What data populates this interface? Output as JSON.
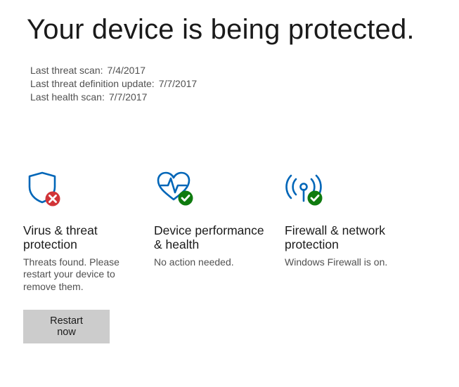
{
  "page": {
    "title": "Your device is being protected."
  },
  "scan": {
    "threat_scan_label": "Last threat scan:",
    "threat_scan_value": "7/4/2017",
    "definition_update_label": "Last threat definition update:",
    "definition_update_value": "7/7/2017",
    "health_scan_label": "Last health scan:",
    "health_scan_value": "7/7/2017"
  },
  "tiles": {
    "virus": {
      "title": "Virus & threat protection",
      "desc": "Threats found. Please restart your device to remove them.",
      "button": "Restart now"
    },
    "performance": {
      "title": "Device performance & health",
      "desc": "No action needed."
    },
    "firewall": {
      "title": "Firewall & network protection",
      "desc": "Windows Firewall is on."
    }
  },
  "colors": {
    "accent": "#0066b8",
    "error": "#d13438",
    "success": "#0f7b0f"
  }
}
